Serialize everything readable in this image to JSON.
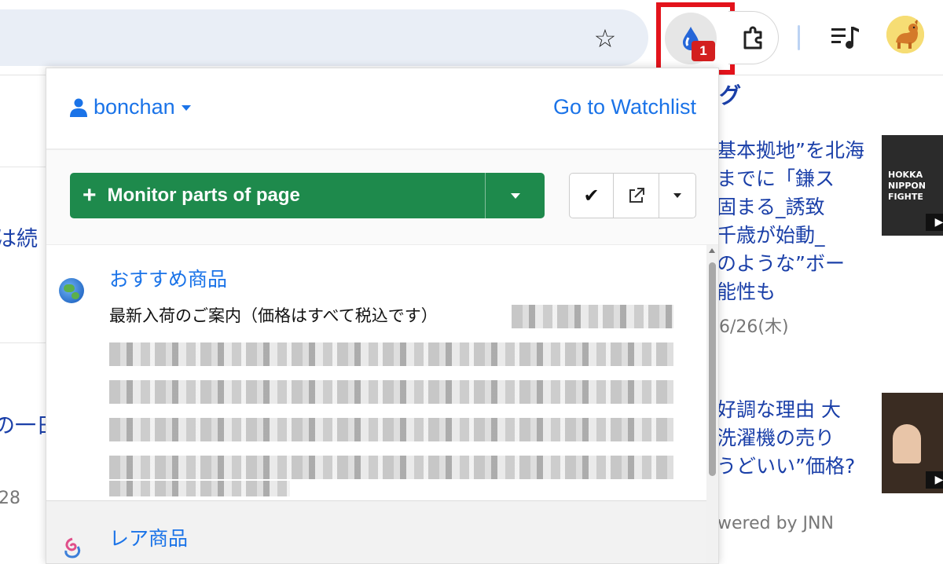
{
  "browser": {
    "extension_badge": "1"
  },
  "background": {
    "left_fragments": [
      "は続",
      "の一日",
      "28"
    ],
    "right_heading": "グ",
    "news1_lines": [
      "基本拠地”を北海",
      "までに「鎌ス",
      "固まる_誘致",
      "千歳が始動_",
      "のような”ボー",
      "能性も"
    ],
    "news1_date": "6/26(木)",
    "news2_lines": [
      "好調な理由 大",
      "洗濯機の売り",
      "うどいい”価格?"
    ],
    "powered_by": "wered by JNN"
  },
  "popup": {
    "user": "bonchan",
    "watchlist_link": "Go to Watchlist",
    "monitor_button": "Monitor parts of page",
    "items": [
      {
        "title": "おすすめ商品",
        "description": "最新入荷のご案内（価格はすべて税込です）"
      },
      {
        "title": "レア商品"
      }
    ]
  },
  "colors": {
    "accent_link": "#1a73e8",
    "monitor_green": "#1e8a4c",
    "highlight_red": "#e3131b",
    "badge_red": "#d31f1f"
  }
}
